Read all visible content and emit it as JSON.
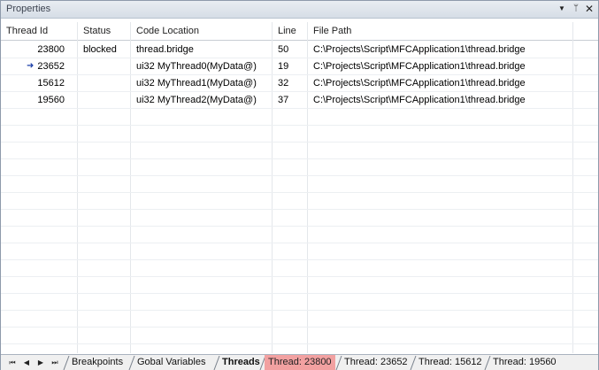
{
  "window": {
    "title": "Properties"
  },
  "controls": {
    "menu": "▼",
    "pin": "ᛘ",
    "close": "✕"
  },
  "columns": [
    "Thread Id",
    "Status",
    "Code Location",
    "Line",
    "File Path"
  ],
  "rows": [
    {
      "thread_id": "23800",
      "status": "blocked",
      "code_location": "thread.bridge",
      "line": "50",
      "file_path": "C:\\Projects\\Script\\MFCApplication1\\thread.bridge",
      "current": false
    },
    {
      "thread_id": "23652",
      "status": "",
      "code_location": "ui32 MyThread0(MyData@)",
      "line": "19",
      "file_path": "C:\\Projects\\Script\\MFCApplication1\\thread.bridge",
      "current": true
    },
    {
      "thread_id": "15612",
      "status": "",
      "code_location": "ui32 MyThread1(MyData@)",
      "line": "32",
      "file_path": "C:\\Projects\\Script\\MFCApplication1\\thread.bridge",
      "current": false
    },
    {
      "thread_id": "19560",
      "status": "",
      "code_location": "ui32 MyThread2(MyData@)",
      "line": "37",
      "file_path": "C:\\Projects\\Script\\MFCApplication1\\thread.bridge",
      "current": false
    }
  ],
  "nav_buttons": {
    "first": "⏮",
    "prev": "◀",
    "next": "▶",
    "last": "⏭"
  },
  "tabs": [
    {
      "label": "Breakpoints",
      "selected": false,
      "highlight": false
    },
    {
      "label": "Gobal Variables",
      "selected": false,
      "highlight": false
    },
    {
      "label": "Threads",
      "selected": true,
      "highlight": false
    },
    {
      "label": "Thread: 23800",
      "selected": false,
      "highlight": true
    },
    {
      "label": "Thread: 23652",
      "selected": false,
      "highlight": false
    },
    {
      "label": "Thread: 15612",
      "selected": false,
      "highlight": false
    },
    {
      "label": "Thread: 19560",
      "selected": false,
      "highlight": false
    }
  ],
  "colors": {
    "highlight_tab": "#f2a1a1",
    "current_arrow": "#1c3fa8",
    "titlebar": "#dde3ea"
  }
}
